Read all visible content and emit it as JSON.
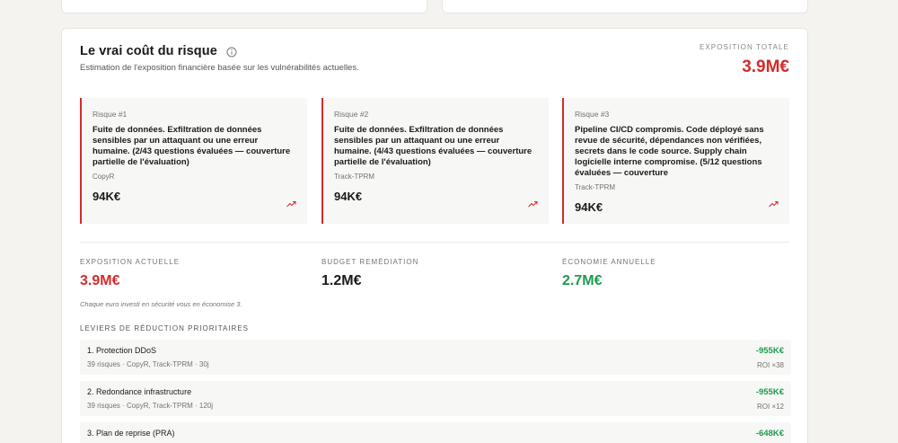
{
  "cost_section": {
    "title": "Le vrai coût du risque",
    "subtitle": "Estimation de l'exposition financière basée sur les vulnérabilités actuelles.",
    "total_label": "EXPOSITION TOTALE",
    "total_value": "3.9M€",
    "info_icon": "info-icon"
  },
  "risks": [
    {
      "label": "Risque #1",
      "description": "Fuite de données. Exfiltration de données sensibles par un attaquant ou une erreur humaine. (2/43 questions évaluées — couverture partielle de l'évaluation)",
      "source": "CopyR",
      "amount": "94K€",
      "trend_icon": "trending-up-icon"
    },
    {
      "label": "Risque #2",
      "description": "Fuite de données. Exfiltration de données sensibles par un attaquant ou une erreur humaine. (4/43 questions évaluées — couverture partielle de l'évaluation)",
      "source": "Track-TPRM",
      "amount": "94K€",
      "trend_icon": "trending-up-icon"
    },
    {
      "label": "Risque #3",
      "description": "Pipeline CI/CD compromis. Code déployé sans revue de sécurité, dépendances non vérifiées, secrets dans le code source. Supply chain logicielle interne compromise. (5/12 questions évaluées — couverture",
      "source": "Track-TPRM",
      "amount": "94K€",
      "trend_icon": "trending-up-icon"
    }
  ],
  "metrics": {
    "current_label": "EXPOSITION ACTUELLE",
    "current_value": "3.9M€",
    "budget_label": "BUDGET REMÉDIATION",
    "budget_value": "1.2M€",
    "savings_label": "ÉCONOMIE ANNUELLE",
    "savings_value": "2.7M€"
  },
  "note": "Chaque euro investi en sécurité vous en économise 3.",
  "levers_title": "LEVIERS DE RÉDUCTION PRIORITAIRES",
  "levers": [
    {
      "name": "1. Protection DDoS",
      "meta": "39 risques · CopyR, Track-TPRM · 30j",
      "saving": "-955K€",
      "roi": "ROI ×38"
    },
    {
      "name": "2. Redondance infrastructure",
      "meta": "39 risques · CopyR, Track-TPRM · 120j",
      "saving": "-955K€",
      "roi": "ROI ×12"
    },
    {
      "name": "3. Plan de reprise (PRA)",
      "meta": "",
      "saving": "-648K€",
      "roi": ""
    }
  ],
  "colors": {
    "danger": "#d42b2b",
    "success": "#1f9a4e",
    "background": "#f4f3f0"
  }
}
